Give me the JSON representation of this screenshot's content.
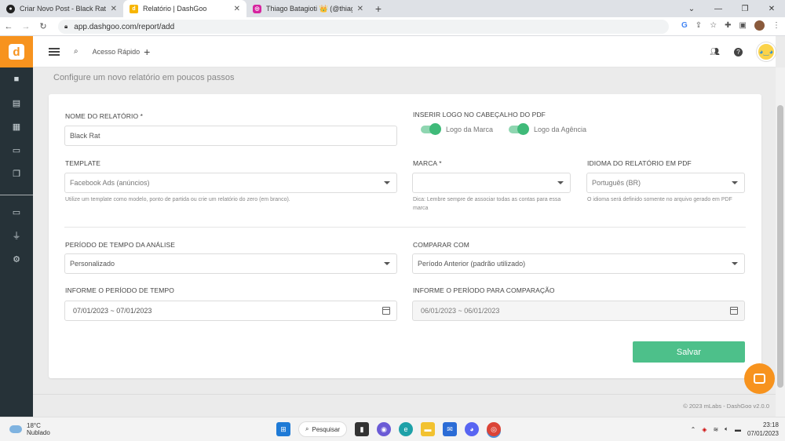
{
  "browser": {
    "tabs": [
      {
        "title": "Criar Novo Post - Black Rat",
        "active": false,
        "icon": "github-icon",
        "color": "#222222"
      },
      {
        "title": "Relatório | DashGoo",
        "active": true,
        "icon": "dashgoo-icon",
        "color": "#f7b500"
      },
      {
        "title": "Thiago Batagioti 👑 (@thiago.ba",
        "active": false,
        "icon": "instagram-icon",
        "color": "#d6249f"
      }
    ],
    "new_tab": "+",
    "url": "app.dashgoo.com/report/add",
    "window_controls": [
      "⌄",
      "—",
      "❐",
      "✕"
    ]
  },
  "header": {
    "quick_access_label": "Acesso Rápido",
    "quick_access_add": "+"
  },
  "page": {
    "subtitle": "Configure um novo relatório em poucos passos"
  },
  "form": {
    "report_name": {
      "label": "NOME DO RELATÓRIO *",
      "value": "Black Rat"
    },
    "logo": {
      "label": "INSERIR LOGO NO CABEÇALHO DO PDF",
      "brand_toggle": "Logo da Marca",
      "agency_toggle": "Logo da Agência",
      "brand_on": true,
      "agency_on": true
    },
    "template": {
      "label": "TEMPLATE",
      "value": "Facebook Ads (anúncios)",
      "help": "Utilize um template como modelo, ponto de partida ou crie um relatório do zero (em branco)."
    },
    "brand": {
      "label": "MARCA *",
      "value": "",
      "help": "Dica: Lembre sempre de associar todas as contas para essa marca"
    },
    "language": {
      "label": "IDIOMA DO RELATÓRIO EM PDF",
      "value": "Português (BR)",
      "help": "O idioma será definido somente no arquivo gerado em PDF"
    },
    "period": {
      "label": "PERÍODO DE TEMPO DA ANÁLISE",
      "value": "Personalizado"
    },
    "compare": {
      "label": "COMPARAR COM",
      "value": "Período Anterior (padrão utilizado)"
    },
    "date_range": {
      "label": "INFORME O PERÍODO DE TEMPO",
      "value": "07/01/2023 ~ 07/01/2023"
    },
    "compare_range": {
      "label": "INFORME O PERÍODO PARA COMPARAÇÃO",
      "value": "06/01/2023 ~ 06/01/2023"
    },
    "save_label": "Salvar"
  },
  "footer": {
    "text": "© 2023 mLabs - DashGoo  v2.0.0"
  },
  "taskbar": {
    "temperature": "18°C",
    "weather": "Nublado",
    "search_label": "Pesquisar",
    "time": "23:18",
    "date": "07/01/2023"
  },
  "colors": {
    "accent": "#f7931e",
    "save": "#4dc08a",
    "sidebar": "#263238",
    "toggle": "#3fba79"
  }
}
